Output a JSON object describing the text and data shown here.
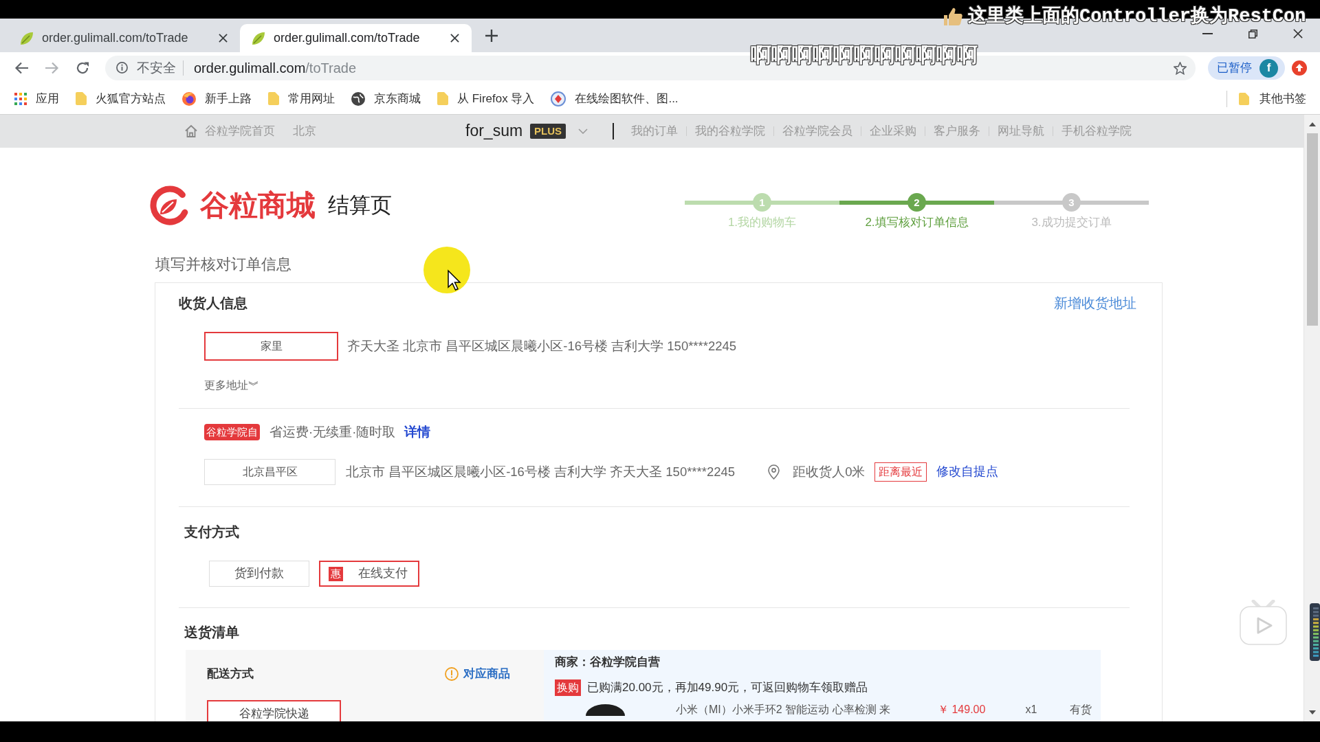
{
  "browser": {
    "tabs": [
      {
        "title": "order.gulimall.com/toTrade",
        "selected": false
      },
      {
        "title": "order.gulimall.com/toTrade",
        "selected": true
      }
    ],
    "security_label": "不安全",
    "url_host": "order.gulimall.com",
    "url_path": "/toTrade",
    "profile": {
      "label": "已暂停",
      "avatar": "f"
    },
    "bookmarks": [
      {
        "label": "应用",
        "kind": "apps"
      },
      {
        "label": "火狐官方站点",
        "kind": "folder"
      },
      {
        "label": "新手上路",
        "kind": "firefox"
      },
      {
        "label": "常用网址",
        "kind": "folder"
      },
      {
        "label": "京东商城",
        "kind": "globe"
      },
      {
        "label": "从 Firefox 导入",
        "kind": "folder"
      },
      {
        "label": "在线绘图软件、图...",
        "kind": "site"
      }
    ],
    "other_bookmarks": "其他书签"
  },
  "site_nav": {
    "home": "谷粒学院首页",
    "city": "北京",
    "username": "for_sum",
    "member_badge": "PLUS",
    "links": [
      "我的订单",
      "我的谷粒学院",
      "谷粒学院会员",
      "企业采购",
      "客户服务",
      "网址导航",
      "手机谷粒学院"
    ]
  },
  "header": {
    "logo": "谷粒商城",
    "subtitle": "结算页",
    "steps": [
      {
        "number": "1",
        "label": "1.我的购物车",
        "done": true,
        "selected": false
      },
      {
        "number": "2",
        "label": "2.填写核对订单信息",
        "done": false,
        "selected": true
      },
      {
        "number": "3",
        "label": "3.成功提交订单",
        "done": false,
        "selected": false
      }
    ]
  },
  "page_title": "填写并核对订单信息",
  "receiver": {
    "title": "收货人信息",
    "add_link": "新增收货地址",
    "addresses": [
      {
        "tag": "家里",
        "detail": "齐天大圣 北京市 昌平区城区晨曦小区-16号楼 吉利大学 150****2245",
        "selected": true
      }
    ],
    "more": "更多地址︾"
  },
  "pickup": {
    "badge": "谷粒学院自",
    "slogan": "省运费·无续重·随时取",
    "details_link": "详情",
    "stations": [
      {
        "name": "北京昌平区",
        "address": "北京市 昌平区城区晨曦小区-16号楼 吉利大学 齐天大圣 150****2245",
        "distance": "距收货人0米",
        "tag": "距离最近",
        "edit_link": "修改自提点",
        "selected": false
      }
    ]
  },
  "payment": {
    "title": "支付方式",
    "methods": [
      {
        "label": "货到付款",
        "selected": false
      },
      {
        "label": "在线支付",
        "badge": "惠",
        "selected": true
      }
    ]
  },
  "delivery": {
    "title": "送货清单",
    "method_title": "配送方式",
    "items_link": "对应商品",
    "methods": [
      {
        "label": "谷粒学院快递",
        "selected": true
      }
    ],
    "seller": "商家：谷粒学院自营",
    "promo_badge": "换购",
    "promo_text": "已购满20.00元，再加49.90元，可返回购物车领取赠品",
    "products": [
      {
        "name": "小米（MI）小米手环2 智能运动 心率检测 来",
        "price": "￥ 149.00",
        "quantity": "x1",
        "stock": "有货"
      }
    ]
  },
  "video_overlay": {
    "danmaku": [
      {
        "text": "这里类上面的Controller换为RestCon",
        "liked": true
      },
      {
        "text": "啊啊啊啊啊啊啊啊啊啊啊",
        "liked": false
      }
    ]
  }
}
